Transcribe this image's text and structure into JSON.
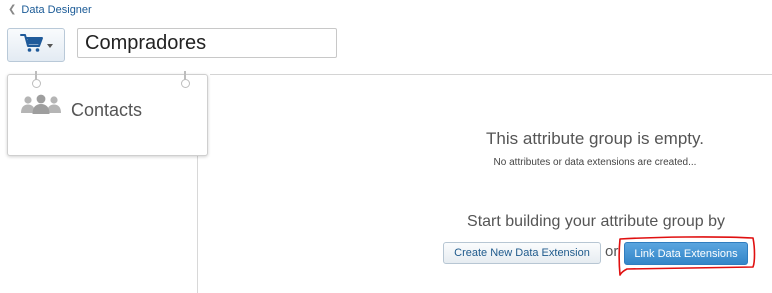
{
  "breadcrumb": {
    "icon": "chevron-left-icon",
    "label": "Data Designer"
  },
  "header": {
    "group_icon": "shopping-cart-icon",
    "group_name": "Compradores"
  },
  "attribute_group_card": {
    "icon": "people-icon",
    "label": "Contacts"
  },
  "empty_state": {
    "title": "This attribute group is empty.",
    "subtitle": "No attributes or data extensions are created...",
    "prompt": "Start building your attribute group by",
    "or_text": "or",
    "create_button_label": "Create New Data Extension",
    "link_button_label": "Link Data Extensions"
  },
  "colors": {
    "link_blue": "#1a5a96",
    "primary_button": "#3b8fd0",
    "annotation_red": "#e01010"
  }
}
